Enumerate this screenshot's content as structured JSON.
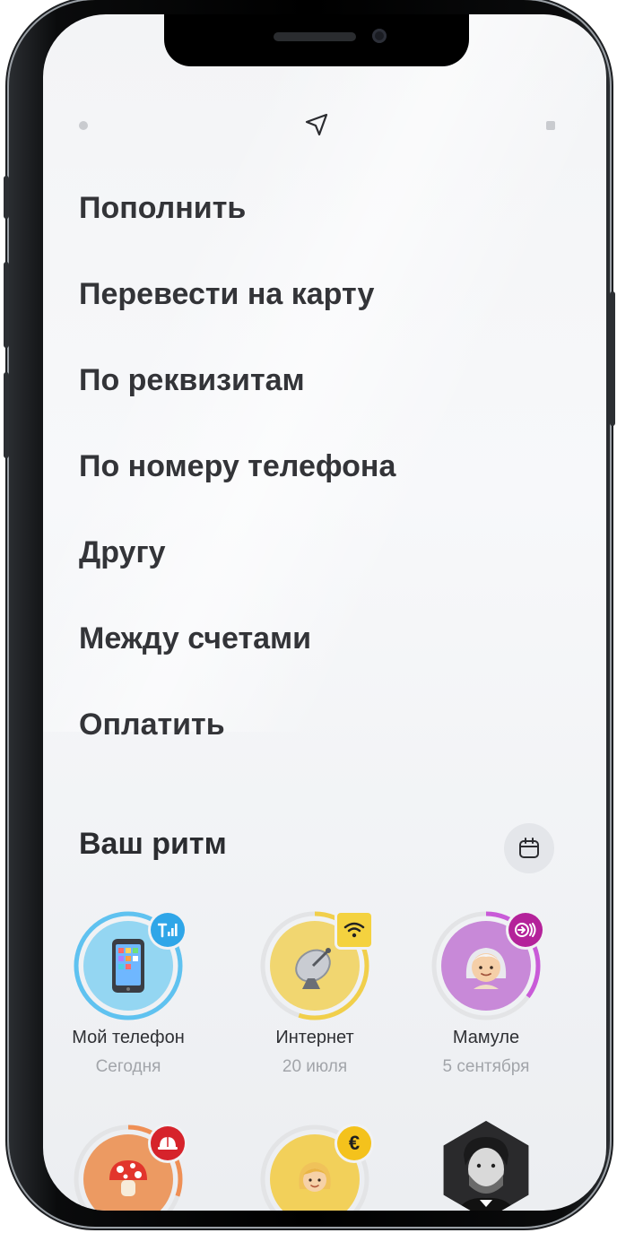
{
  "menu": {
    "items": [
      {
        "label": "Пополнить"
      },
      {
        "label": "Перевести на карту"
      },
      {
        "label": "По реквизитам"
      },
      {
        "label": "По номеру телефона"
      },
      {
        "label": "Другу"
      },
      {
        "label": "Между счетами"
      },
      {
        "label": "Оплатить"
      }
    ]
  },
  "rhythm": {
    "title": "Ваш ритм",
    "calendar_icon": "calendar-icon",
    "tiles": [
      {
        "title": "Мой телефон",
        "date": "Сегодня",
        "icon": "mobile-phone",
        "badge_icon": "signal-icon",
        "ring_color": "#5fc2f0",
        "progress": 1.0
      },
      {
        "title": "Интернет",
        "date": "20 июля",
        "icon": "satellite-dish",
        "badge_icon": "wifi-icon",
        "ring_color": "#f1cf4a",
        "progress": 0.55
      },
      {
        "title": "Мамуле",
        "date": "5 сентября",
        "icon": "grandmother-emoji",
        "badge_icon": "transfer-arrow-icon",
        "ring_color": "#c95bd8",
        "progress": 0.35
      },
      {
        "title": "",
        "date": "",
        "icon": "mushroom",
        "badge_icon": "helmet-icon",
        "ring_color": "#ef8f55",
        "progress": 0.3
      },
      {
        "title": "",
        "date": "",
        "icon": "girl-emoji",
        "badge_icon": "euro-icon",
        "ring_color": "#f2d05a",
        "progress": 0.0
      },
      {
        "title": "",
        "date": "",
        "icon": "person-photo",
        "badge_icon": "",
        "ring_color": "#222222",
        "progress": 0.0
      }
    ]
  },
  "colors": {
    "text": "#333438",
    "muted": "#a2a5aa",
    "phone_badge": "#2fa6e8",
    "internet_badge": "#f4d23f",
    "mom_badge": "#b4229a",
    "helmet_badge": "#d6232b",
    "euro_badge": "#f4c21c"
  }
}
